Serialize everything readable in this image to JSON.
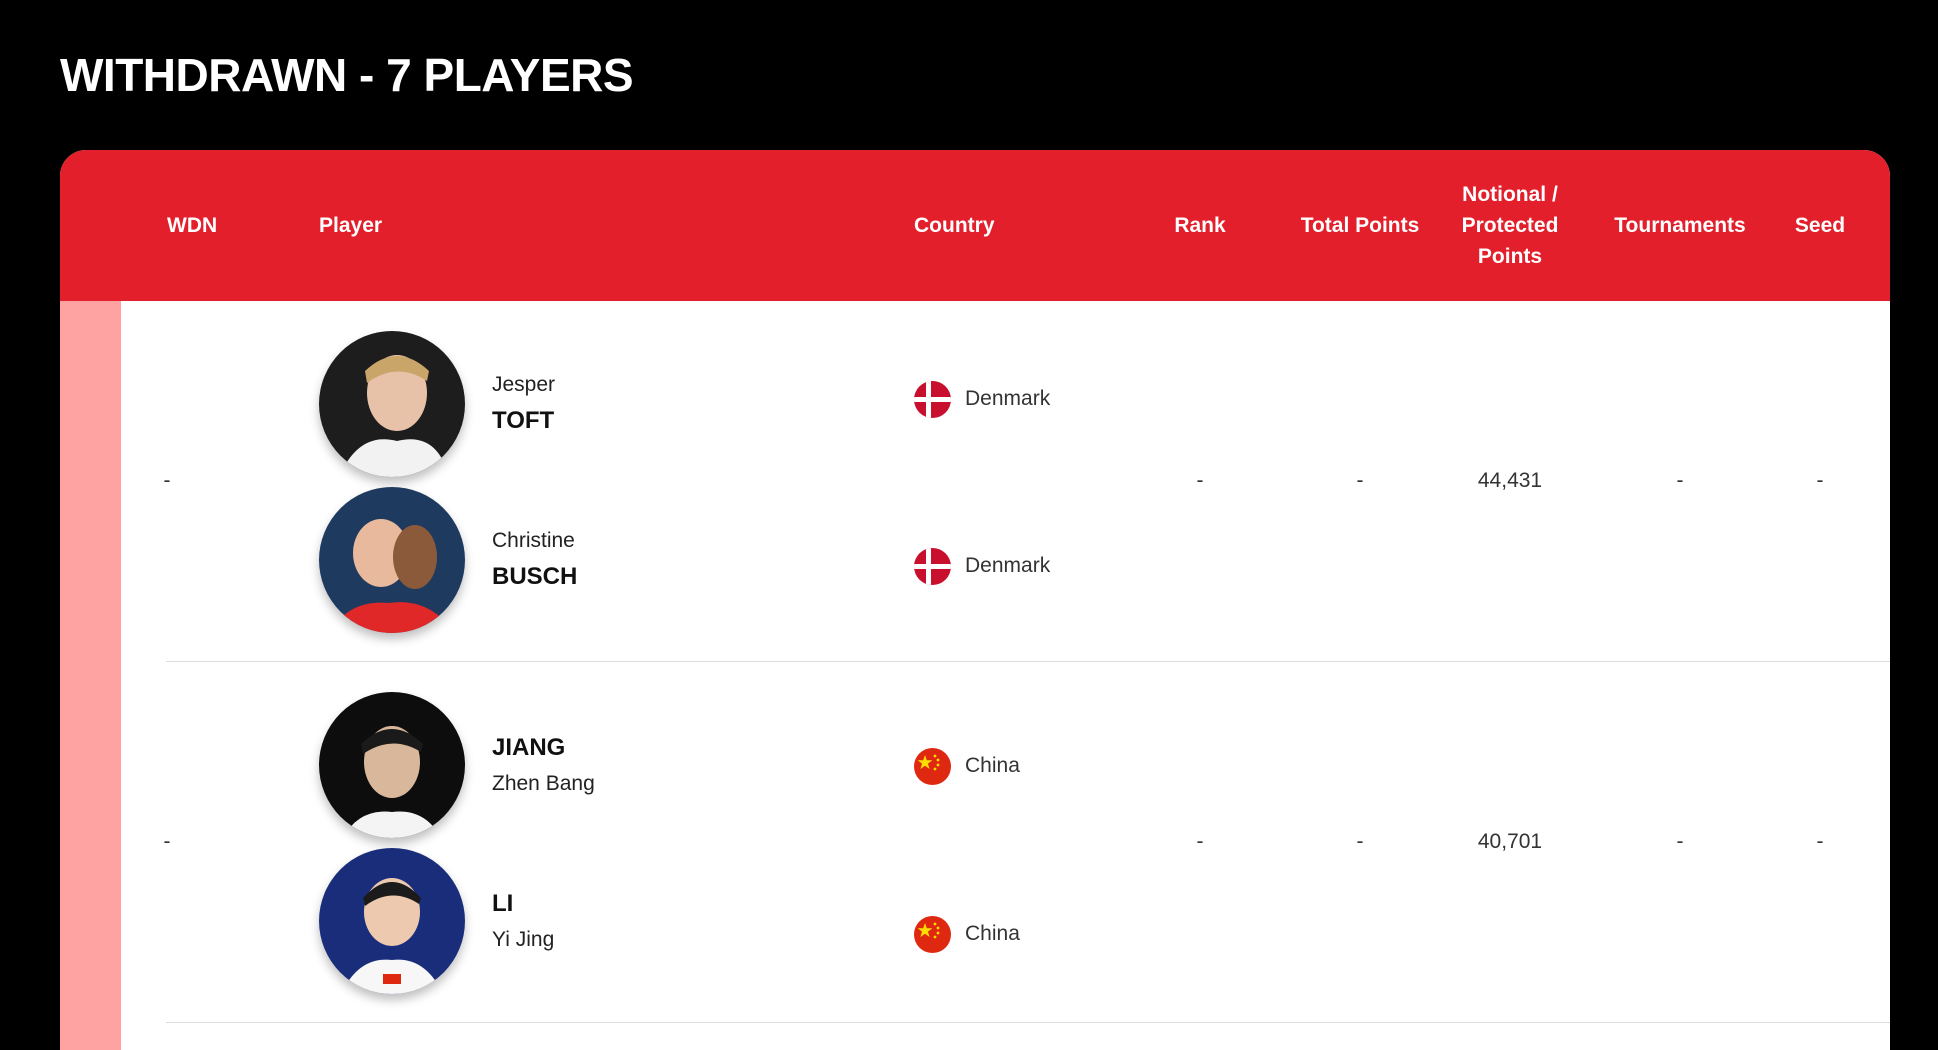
{
  "page": {
    "title": "WITHDRAWN - 7 PLAYERS"
  },
  "table": {
    "headers": {
      "wdn": "WDN",
      "player": "Player",
      "country": "Country",
      "rank": "Rank",
      "total_points": "Total Points",
      "notional": "Notional / Protected Points",
      "tournaments": "Tournaments",
      "seed": "Seed"
    },
    "rows": [
      {
        "wdn": "-",
        "rank": "-",
        "total_points": "-",
        "notional_points": "44,431",
        "tournaments": "-",
        "seed": "-",
        "players": [
          {
            "first": "Jesper",
            "last": "TOFT",
            "country": "Denmark",
            "flag_icon": "denmark-flag-icon",
            "photo_bg": "#2a2a2a"
          },
          {
            "first": "Christine",
            "last": "BUSCH",
            "country": "Denmark",
            "flag_icon": "denmark-flag-icon",
            "photo_bg": "#1f3a5f"
          }
        ]
      },
      {
        "wdn": "-",
        "rank": "-",
        "total_points": "-",
        "notional_points": "40,701",
        "tournaments": "-",
        "seed": "-",
        "players": [
          {
            "last": "JIANG",
            "first": "Zhen Bang",
            "country": "China",
            "flag_icon": "china-flag-icon",
            "photo_bg": "#0d0d0d"
          },
          {
            "last": "LI",
            "first": "Yi Jing",
            "country": "China",
            "flag_icon": "china-flag-icon",
            "photo_bg": "#1a2d7a"
          }
        ]
      }
    ]
  },
  "colors": {
    "header_red": "#e21f2b",
    "stripe_pink": "#fea2a2",
    "denmark_red": "#c8102e",
    "china_red": "#de2910",
    "china_yellow": "#ffde00"
  }
}
